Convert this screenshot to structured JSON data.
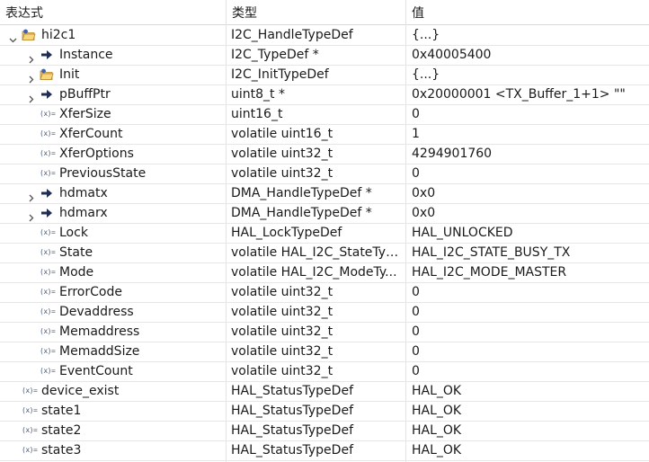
{
  "columns": {
    "expression": "表达式",
    "type": "类型",
    "value": "值"
  },
  "rows": [
    {
      "name": "hi2c1",
      "type": "I2C_HandleTypeDef",
      "value": "{...}",
      "level": 0,
      "toggle": "expanded",
      "icon": "struct"
    },
    {
      "name": "Instance",
      "type": "I2C_TypeDef *",
      "value": "0x40005400",
      "level": 1,
      "toggle": "collapsed",
      "icon": "pointer"
    },
    {
      "name": "Init",
      "type": "I2C_InitTypeDef",
      "value": "{...}",
      "level": 1,
      "toggle": "collapsed",
      "icon": "struct"
    },
    {
      "name": "pBuffPtr",
      "type": "uint8_t *",
      "value": "0x20000001 <TX_Buffer_1+1> \"\"",
      "level": 1,
      "toggle": "collapsed",
      "icon": "pointer"
    },
    {
      "name": "XferSize",
      "type": "uint16_t",
      "value": "0",
      "level": 1,
      "toggle": "none",
      "icon": "variable"
    },
    {
      "name": "XferCount",
      "type": "volatile uint16_t",
      "value": "1",
      "level": 1,
      "toggle": "none",
      "icon": "variable"
    },
    {
      "name": "XferOptions",
      "type": "volatile uint32_t",
      "value": "4294901760",
      "level": 1,
      "toggle": "none",
      "icon": "variable"
    },
    {
      "name": "PreviousState",
      "type": "volatile uint32_t",
      "value": "0",
      "level": 1,
      "toggle": "none",
      "icon": "variable"
    },
    {
      "name": "hdmatx",
      "type": "DMA_HandleTypeDef *",
      "value": "0x0",
      "level": 1,
      "toggle": "collapsed",
      "icon": "pointer"
    },
    {
      "name": "hdmarx",
      "type": "DMA_HandleTypeDef *",
      "value": "0x0",
      "level": 1,
      "toggle": "collapsed",
      "icon": "pointer"
    },
    {
      "name": "Lock",
      "type": "HAL_LockTypeDef",
      "value": "HAL_UNLOCKED",
      "level": 1,
      "toggle": "none",
      "icon": "variable"
    },
    {
      "name": "State",
      "type": "volatile HAL_I2C_StateTyp...",
      "value": "HAL_I2C_STATE_BUSY_TX",
      "level": 1,
      "toggle": "none",
      "icon": "variable"
    },
    {
      "name": "Mode",
      "type": "volatile HAL_I2C_ModeTy...",
      "value": "HAL_I2C_MODE_MASTER",
      "level": 1,
      "toggle": "none",
      "icon": "variable"
    },
    {
      "name": "ErrorCode",
      "type": "volatile uint32_t",
      "value": "0",
      "level": 1,
      "toggle": "none",
      "icon": "variable"
    },
    {
      "name": "Devaddress",
      "type": "volatile uint32_t",
      "value": "0",
      "level": 1,
      "toggle": "none",
      "icon": "variable"
    },
    {
      "name": "Memaddress",
      "type": "volatile uint32_t",
      "value": "0",
      "level": 1,
      "toggle": "none",
      "icon": "variable"
    },
    {
      "name": "MemaddSize",
      "type": "volatile uint32_t",
      "value": "0",
      "level": 1,
      "toggle": "none",
      "icon": "variable"
    },
    {
      "name": "EventCount",
      "type": "volatile uint32_t",
      "value": "0",
      "level": 1,
      "toggle": "none",
      "icon": "variable"
    },
    {
      "name": "device_exist",
      "type": "HAL_StatusTypeDef",
      "value": "HAL_OK",
      "level": 0,
      "toggle": "none",
      "icon": "variable"
    },
    {
      "name": "state1",
      "type": "HAL_StatusTypeDef",
      "value": "HAL_OK",
      "level": 0,
      "toggle": "none",
      "icon": "variable"
    },
    {
      "name": "state2",
      "type": "HAL_StatusTypeDef",
      "value": "HAL_OK",
      "level": 0,
      "toggle": "none",
      "icon": "variable"
    },
    {
      "name": "state3",
      "type": "HAL_StatusTypeDef",
      "value": "HAL_OK",
      "level": 0,
      "toggle": "none",
      "icon": "variable"
    }
  ],
  "colors": {
    "grid": "#e3e3e3",
    "variable_icon": "#4a5a78",
    "pointer_icon": "#1f2d52",
    "struct_icon": "#f2c14e"
  }
}
